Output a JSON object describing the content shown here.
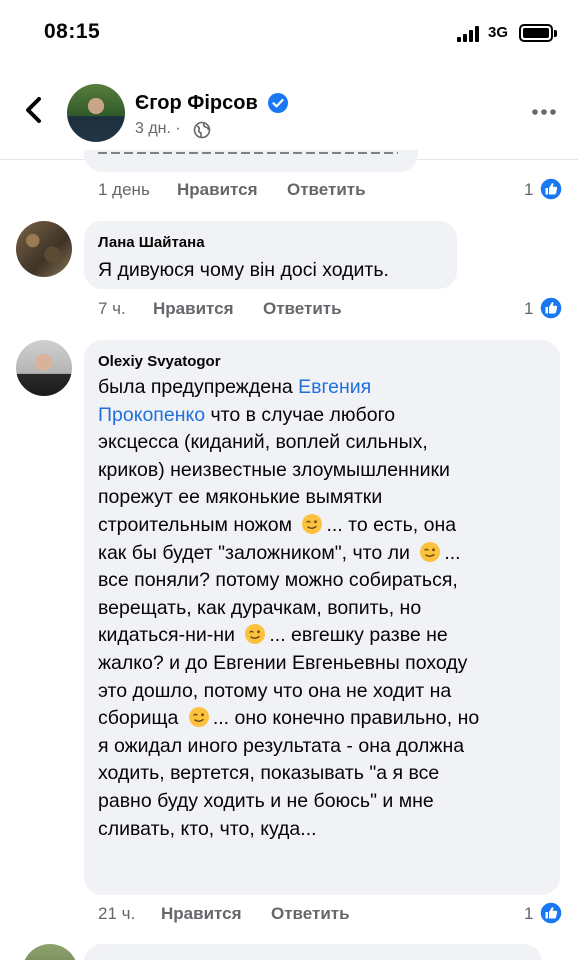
{
  "status_bar": {
    "time": "08:15",
    "network": "3G"
  },
  "post_header": {
    "author": "Єгор Фірсов",
    "meta": "3 дн. ·"
  },
  "comments": [
    {
      "time": "1 день",
      "like_label": "Нравится",
      "reply_label": "Ответить",
      "reactions": "1"
    },
    {
      "author": "Лана Шайтана",
      "text": "Я дивуюся чому він досі ходить.",
      "time": "7 ч.",
      "like_label": "Нравится",
      "reply_label": "Ответить",
      "reactions": "1"
    },
    {
      "author": "Olexiy Svyatogor",
      "lines": [
        [
          "была предупреждена ",
          "Евгения"
        ],
        [
          "Прокопенко",
          " что в случае любого"
        ],
        [
          "эксцесса (киданий, воплей сильных,"
        ],
        [
          "криков) неизвестные злоумышленники"
        ],
        [
          "порежут ее мяконькие вымятки"
        ],
        [
          "строительным ножом ",
          "... то есть, она"
        ],
        [
          "как бы будет \"заложником\", что ли ",
          "..."
        ],
        [
          "все поняли? потому можно собираться,"
        ],
        [
          "верещать, как дурачкам, вопить, но"
        ],
        [
          "кидаться-ни-ни ",
          "... евгешку разве не"
        ],
        [
          "жалко? и до Евгении Евгеньевны походу"
        ],
        [
          "это дошло, потому что она не ходит на"
        ],
        [
          "сборища ",
          "... оно конечно правильно, но"
        ],
        [
          "я ожидал иного результата - она должна"
        ],
        [
          "ходить, вертется, показывать \"а я все"
        ],
        [
          "равно буду ходить и не боюсь\" и мне"
        ],
        [
          "сливать, кто, что, куда..."
        ]
      ],
      "time": "21 ч.",
      "like_label": "Нравится",
      "reply_label": "Ответить",
      "reactions": "1"
    }
  ],
  "icons": {
    "back": "chevron-left-icon",
    "verified": "verified-badge-icon",
    "globe": "globe-icon",
    "more": "more-horizontal-icon",
    "like": "like-reaction-icon",
    "emoji": "winking-face-icon"
  },
  "colors": {
    "accent": "#1877f2",
    "link": "#216fdb",
    "bubble": "#f0f2f5",
    "secondary_text": "#65676b"
  }
}
